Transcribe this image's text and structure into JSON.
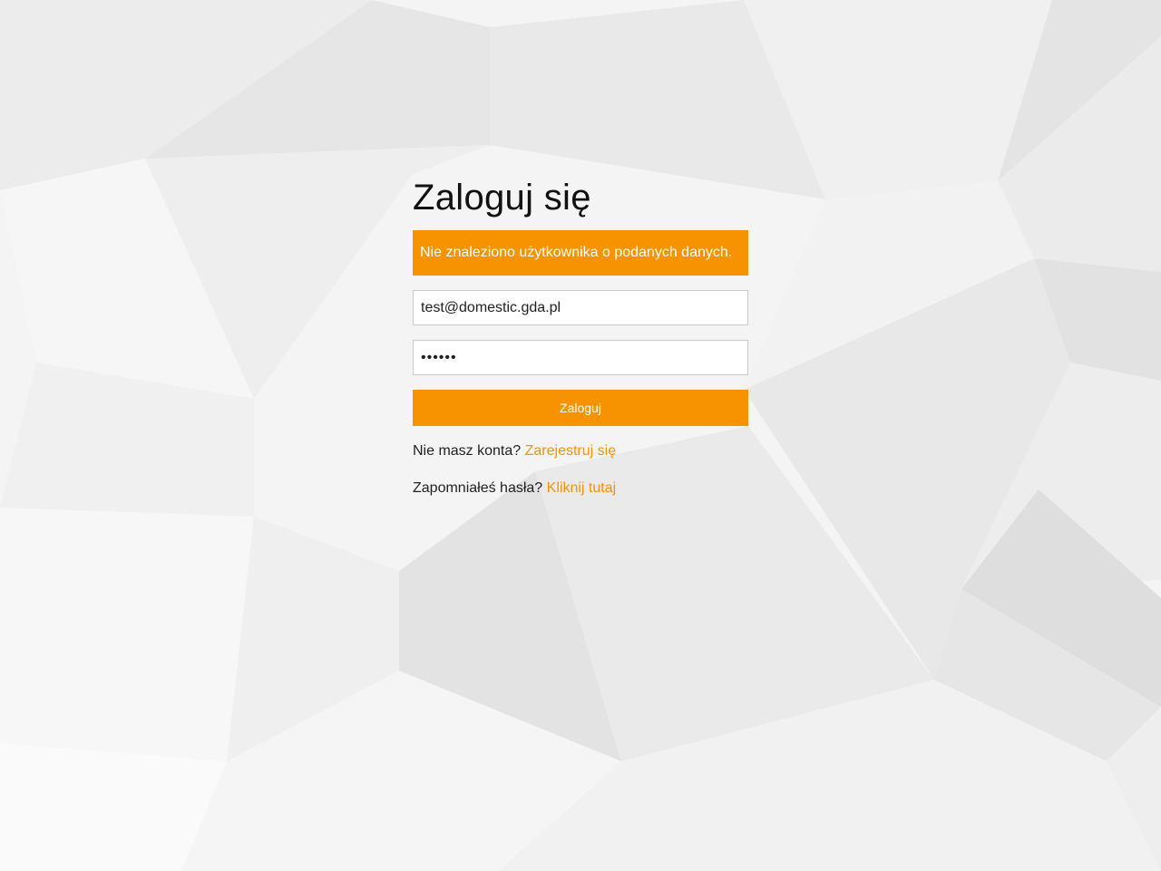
{
  "colors": {
    "accent": "#f79200",
    "background": "#f3f3f3",
    "text": "#222222"
  },
  "login": {
    "title": "Zaloguj się",
    "error_message": "Nie znaleziono użytkownika o podanych danych.",
    "email_value": "test@domestic.gda.pl",
    "password_value": "123456",
    "submit_label": "Zaloguj",
    "register_prompt": "Nie masz konta?",
    "register_link": "Zarejestruj się",
    "forgot_prompt": "Zapomniałeś hasła?",
    "forgot_link": "Kliknij tutaj"
  }
}
